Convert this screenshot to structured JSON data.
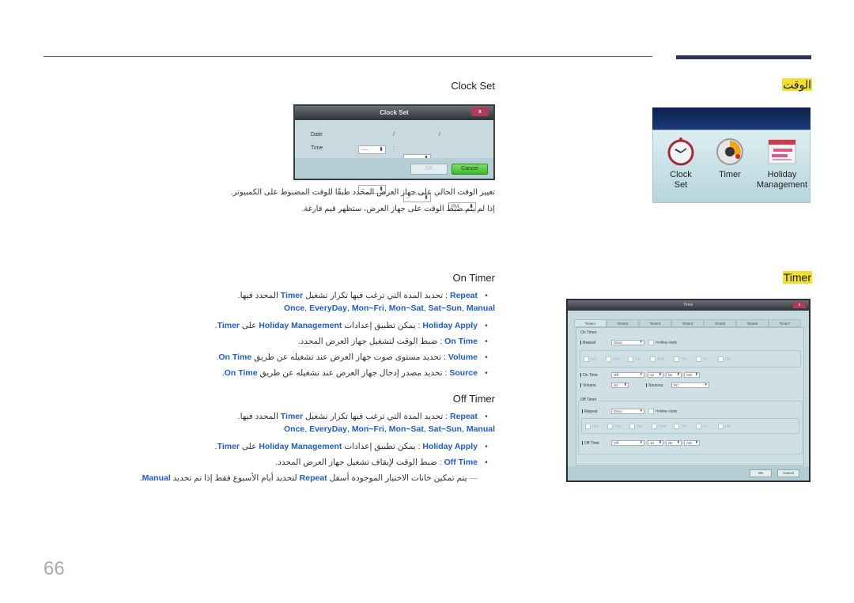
{
  "page": {
    "number": "66"
  },
  "sections": {
    "time": {
      "heading": "الوقت"
    },
    "timer": {
      "heading": "Timer"
    }
  },
  "menu": {
    "items": [
      {
        "line1": "Clock",
        "line2": "Set",
        "icon": "alarm-clock-icon"
      },
      {
        "line1": "Timer",
        "line2": "",
        "icon": "timer-dial-icon"
      },
      {
        "line1": "Holiday",
        "line2": "Management",
        "icon": "calendar-icon"
      }
    ]
  },
  "clock_set": {
    "title": "Clock Set",
    "dialog": {
      "title": "Clock Set",
      "close": "x",
      "date_label": "Date",
      "time_label": "Time",
      "date_values": [
        "----",
        "--",
        "--"
      ],
      "date_sep": "/",
      "time_values": [
        "--",
        "--",
        "PM"
      ],
      "time_sep": ":",
      "ok": "OK",
      "cancel": "Cancel"
    },
    "desc1": "تغيير الوقت الحالي على جهاز العرض المحدد طبقًا للوقت المضبوط على الكمبيوتر.",
    "desc2": "إذا لم يتم ضبط الوقت على جهاز العرض، ستظهر قيم فارغة."
  },
  "on_timer": {
    "title": "On Timer",
    "repeat": {
      "kw": "Repeat",
      "text_a": " : تحديد المدة التي ترغب فيها تكرار تشغيل ",
      "kw2": "Timer",
      "text_b": " المحدد فيها."
    },
    "repeat_options": [
      "Once",
      "EveryDay",
      "Mon~Fri",
      "Mon~Sat",
      "Sat~Sun",
      "Manual"
    ],
    "holiday": {
      "kw": "Holiday Apply",
      "text_a": " : يمكن تطبيق إعدادات ",
      "kw2": "Holiday Management",
      "text_b": " على ",
      "kw3": "Timer",
      "end": "."
    },
    "on_time": {
      "kw": "On Time",
      "text": " : ضبط الوقت لتشغيل جهاز العرض المحدد."
    },
    "volume": {
      "kw": "Volume",
      "text": " : تحديد مستوى صوت جهاز العرض عند تشغيله عن طريق ",
      "kw2": "On Time",
      "end": "."
    },
    "source": {
      "kw": "Source",
      "text": " : تحديد مصدر إدخال جهاز العرض عند تشغيله عن طريق ",
      "kw2": "On Time",
      "end": "."
    }
  },
  "off_timer": {
    "title": "Off Timer",
    "repeat": {
      "kw": "Repeat",
      "text_a": " : تحديد المدة التي ترغب فيها تكرار تشغيل ",
      "kw2": "Timer",
      "text_b": " المحدد فيها."
    },
    "repeat_options": [
      "Once",
      "EveryDay",
      "Mon~Fri",
      "Mon~Sat",
      "Sat~Sun",
      "Manual"
    ],
    "holiday": {
      "kw": "Holiday Apply",
      "text_a": " : يمكن تطبيق إعدادات ",
      "kw2": "Holiday Management",
      "text_b": " على ",
      "kw3": "Timer",
      "end": "."
    },
    "off_time": {
      "kw": "Off Time",
      "text": " : ضبط الوقت لإيقاف تشغيل جهاز العرض المحدد."
    },
    "note": {
      "dash": "—",
      "text_a": " يتم تمكين خانات الاختيار الموجودة أسفل ",
      "kw": "Repeat",
      "text_b": " لتحديد أيام الأسبوع فقط إذا تم تحديد ",
      "kw2": "Manual",
      "end": "."
    }
  },
  "timer_dialog": {
    "title": "Timer",
    "close": "x",
    "tabs": [
      "Timer1",
      "Timer2",
      "Timer3",
      "Timer4",
      "Timer5",
      "Timer6",
      "Timer7"
    ],
    "on_group": "On Timer",
    "off_group": "Off Timer",
    "repeat_label": "Repeat",
    "repeat_value": "Once",
    "holiday_apply": "Holiday Apply",
    "days": [
      "Sun",
      "Mon",
      "Tue",
      "Wed",
      "Thu",
      "Fri",
      "Sat"
    ],
    "on_time_label": "On Time",
    "on_time_value": "Off",
    "hour": "12",
    "minute": "00",
    "ampm": "AM",
    "volume_label": "Volume",
    "volume_value": "10",
    "source_label": "Sources",
    "source_value": "PC",
    "off_time_label": "Off Time",
    "off_time_value": "Off",
    "ok": "OK",
    "cancel": "Cancel"
  }
}
